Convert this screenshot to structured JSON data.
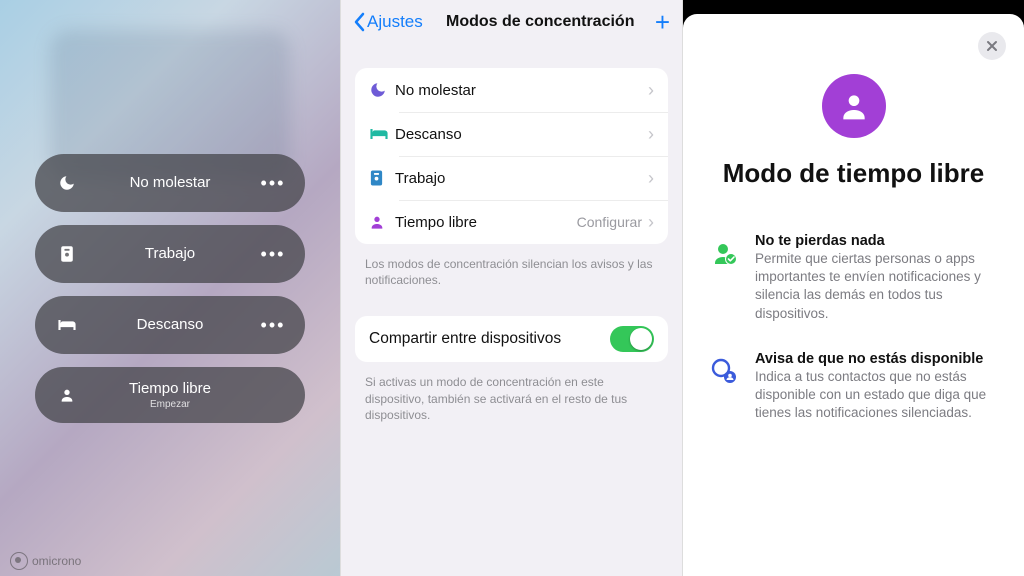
{
  "left": {
    "pills": [
      {
        "icon": "moon-icon",
        "label": "No molestar",
        "sublabel": "",
        "more": true
      },
      {
        "icon": "badge-icon",
        "label": "Trabajo",
        "sublabel": "",
        "more": true
      },
      {
        "icon": "bed-icon",
        "label": "Descanso",
        "sublabel": "",
        "more": true
      },
      {
        "icon": "person-icon",
        "label": "Tiempo libre",
        "sublabel": "Empezar",
        "more": false
      }
    ]
  },
  "mid": {
    "back_label": "Ajustes",
    "title": "Modos de concentración",
    "rows": [
      {
        "icon": "moon-icon",
        "icon_color": "#6e5bd6",
        "label": "No molestar",
        "accessory": ""
      },
      {
        "icon": "bed-icon",
        "icon_color": "#1fb9a2",
        "label": "Descanso",
        "accessory": ""
      },
      {
        "icon": "badge-icon",
        "icon_color": "#2f87c6",
        "label": "Trabajo",
        "accessory": ""
      },
      {
        "icon": "person-icon",
        "icon_color": "#a23fd6",
        "label": "Tiempo libre",
        "accessory": "Configurar"
      }
    ],
    "footnote1": "Los modos de concentración silencian los avisos y las notificaciones.",
    "share_label": "Compartir entre dispositivos",
    "share_on": true,
    "footnote2": "Si activas un modo de concentración en este dispositivo, también se activará en el resto de tus dispositivos."
  },
  "right": {
    "title": "Modo de tiempo libre",
    "features": [
      {
        "title": "No te pierdas nada",
        "desc": "Permite que ciertas personas o apps importantes te envíen notificaciones y silencia las demás en todos tus dispositivos."
      },
      {
        "title": "Avisa de que no estás disponible",
        "desc": "Indica a tus contactos que no estás disponible con un estado que diga que tienes las notificaciones silenciadas."
      }
    ]
  },
  "watermark": "omicrono"
}
